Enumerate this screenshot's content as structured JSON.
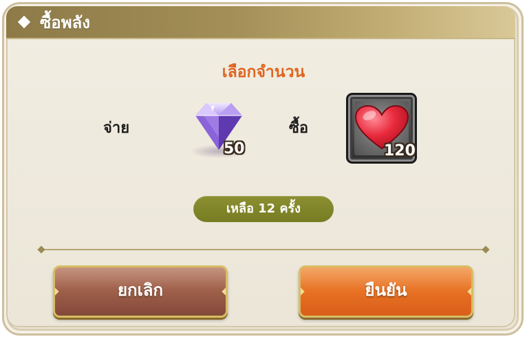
{
  "dialog": {
    "title": "ซื้อพลัง",
    "title_icon": "diamond-bullet-icon",
    "subtitle": "เลือกจำนวน"
  },
  "trade": {
    "pay_label": "จ่าย",
    "pay_item": {
      "icon": "purple-gem-icon",
      "quantity": "50"
    },
    "buy_label": "ซื้อ",
    "buy_item": {
      "icon": "red-heart-icon",
      "quantity": "120"
    }
  },
  "remaining": {
    "text": "เหลือ 12 ครั้ง"
  },
  "buttons": {
    "cancel_label": "ยกเลิก",
    "confirm_label": "ยืนยัน"
  },
  "colors": {
    "title_bar": "#a48f58",
    "subtitle": "#e0641f",
    "remaining_pill": "#808428",
    "cancel_button": "#9b5d47",
    "confirm_button": "#e66f22",
    "background": "#ece6d6"
  }
}
